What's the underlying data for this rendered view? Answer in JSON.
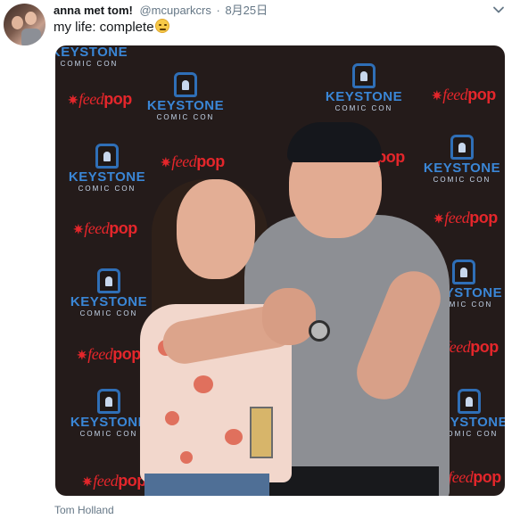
{
  "tweet": {
    "display_name": "anna met tom!",
    "handle": "@mcuparkcrs",
    "separator": "·",
    "date": "8月25日",
    "text": "my life: complete",
    "emoji_icon": "relieved-face-emoji",
    "tagged_user": "Tom Holland"
  },
  "photo": {
    "backdrop_brand": "KEYSTONE",
    "backdrop_subtitle": "COMIC CON",
    "sponsor_feed": "feed",
    "sponsor_pop": "pop",
    "sponsor_star": "✷",
    "colors": {
      "backdrop": "#241b1a",
      "keystone_blue": "#3a86d6",
      "reedpop_red": "#e4262b"
    }
  },
  "icons": {
    "caret": "chevron-down-icon"
  }
}
